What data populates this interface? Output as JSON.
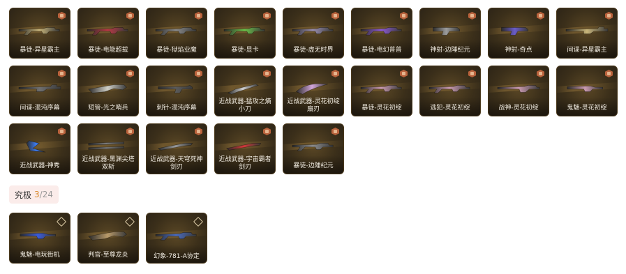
{
  "colors": {
    "card_bg": "#3b2f1a",
    "premium_badge": "#b9623c",
    "ultimate_badge": "#d9c9a4",
    "section_bg": "#fbecea",
    "count": "#d98a2f"
  },
  "premium_items": [
    {
      "label": "暴徒-异星霸主",
      "accent": "#c8b57a",
      "icon": "rifle-icon"
    },
    {
      "label": "暴徒-电能超载",
      "accent": "#b83a45",
      "icon": "rifle-icon"
    },
    {
      "label": "暴徒-狱焰业魔",
      "accent": "#8a8a8a",
      "icon": "rifle-icon"
    },
    {
      "label": "暴徒-显卡",
      "accent": "#6cc24a",
      "icon": "rifle-icon"
    },
    {
      "label": "暴徒-虚无时界",
      "accent": "#9a8fb0",
      "icon": "rifle-icon"
    },
    {
      "label": "暴徒-电幻普普",
      "accent": "#8e5bd6",
      "icon": "rifle-icon"
    },
    {
      "label": "神射-边陲纪元",
      "accent": "#9c9c9c",
      "icon": "revolver-icon"
    },
    {
      "label": "神射-奇点",
      "accent": "#6a5cc8",
      "icon": "revolver-icon"
    },
    {
      "label": "间谍-异星霸主",
      "accent": "#c8b57a",
      "icon": "sniper-icon"
    },
    {
      "label": "间谍-混沌序幕",
      "accent": "#6f6f6f",
      "icon": "sniper-icon"
    },
    {
      "label": "短管-光之哨兵",
      "accent": "#d0cfc6",
      "icon": "shotgun-icon"
    },
    {
      "label": "刺针-混沌序幕",
      "accent": "#5c5c5c",
      "icon": "smg-icon"
    },
    {
      "label": "近战武器-猛攻之熵小刀",
      "accent": "#cfcfcf",
      "icon": "knife-icon"
    },
    {
      "label": "近战武器-灵花初绽扇刃",
      "accent": "#d2a6d8",
      "icon": "fan-blade-icon"
    },
    {
      "label": "暴徒-灵花初绽",
      "accent": "#c99ab0",
      "icon": "rifle-icon"
    },
    {
      "label": "逃犯-灵花初绽",
      "accent": "#c99ab0",
      "icon": "rifle-icon"
    },
    {
      "label": "战神-灵花初绽",
      "accent": "#c99ab0",
      "icon": "machine-gun-icon"
    },
    {
      "label": "鬼魅-灵花初绽",
      "accent": "#c99ab0",
      "icon": "pistol-icon"
    },
    {
      "label": "近战武器-神秀",
      "accent": "#3d7bf0",
      "icon": "axe-icon"
    },
    {
      "label": "近战武器-黑渊尖塔双斩",
      "accent": "#7a7a7a",
      "icon": "dual-blade-icon"
    },
    {
      "label": "近战武器-天穹死神剑刃",
      "accent": "#9a9a9a",
      "icon": "sword-icon"
    },
    {
      "label": "近战武器-宇宙霸者剑刃",
      "accent": "#d23a3a",
      "icon": "sword-icon"
    },
    {
      "label": "暴徒-边陲纪元",
      "accent": "#8c8c8c",
      "icon": "rifle-icon"
    }
  ],
  "ultimate_section": {
    "title": "究极",
    "count": "3",
    "total": "/24"
  },
  "ultimate_items": [
    {
      "label": "鬼魅-电玩街机",
      "accent": "#3a5bd8",
      "icon": "pistol-icon"
    },
    {
      "label": "判官-至尊龙炎",
      "accent": "#b89a6a",
      "icon": "shotgun-icon"
    },
    {
      "label": "幻象-781-A协定",
      "accent": "#4a6cc0",
      "icon": "rifle-icon"
    }
  ]
}
